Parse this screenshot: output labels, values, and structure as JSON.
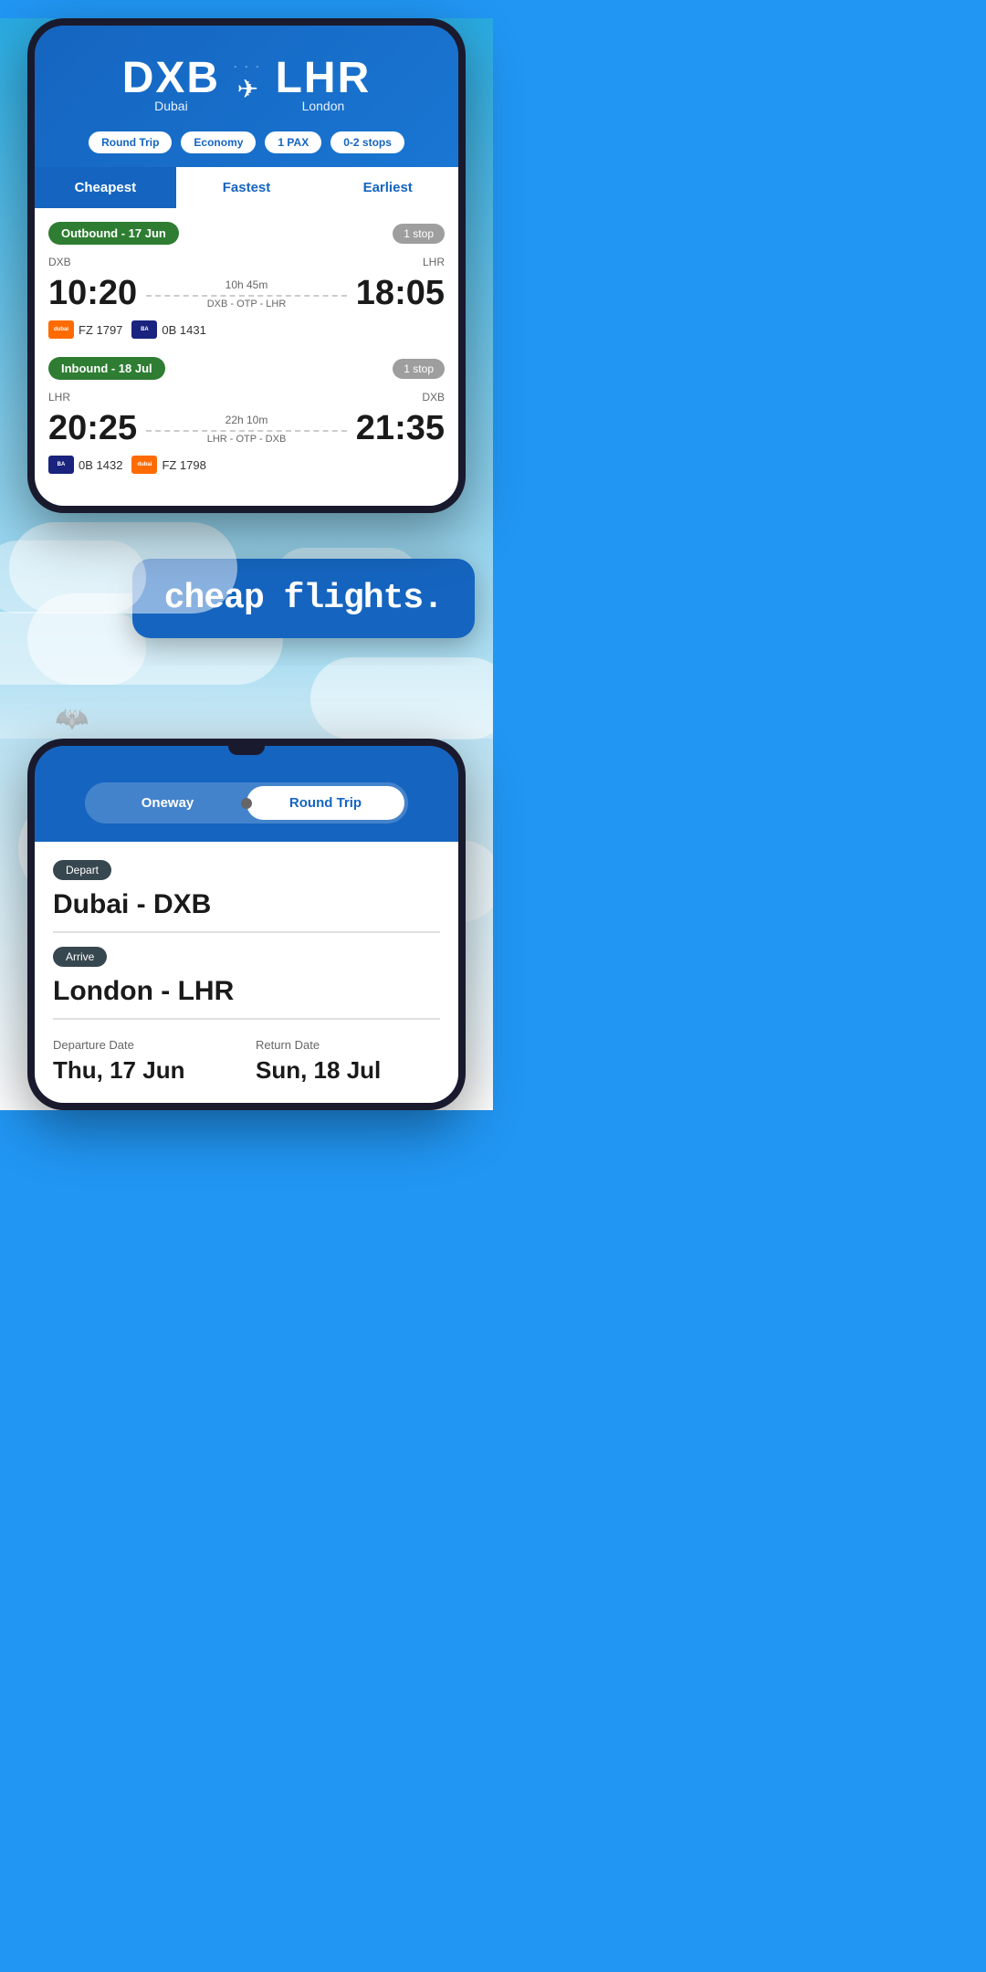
{
  "header": {
    "origin_code": "DXB",
    "origin_city": "Dubai",
    "destination_code": "LHR",
    "destination_city": "London",
    "trip_type": "Round Trip",
    "cabin_class": "Economy",
    "passengers": "1 PAX",
    "stops": "0-2 stops"
  },
  "tabs": {
    "cheapest": "Cheapest",
    "fastest": "Fastest",
    "earliest": "Earliest",
    "active": "cheapest"
  },
  "outbound": {
    "label": "Outbound - 17 Jun",
    "stops_badge": "1 stop",
    "departure_airport": "DXB",
    "arrival_airport": "LHR",
    "departure_time": "10:20",
    "arrival_time": "18:05",
    "duration": "10h 45m",
    "route_path": "DXB - OTP - LHR",
    "airline1_code": "FZ 1797",
    "airline1_color": "orange",
    "airline2_code": "0B 1431",
    "airline2_color": "blue"
  },
  "inbound": {
    "label": "Inbound - 18 Jul",
    "stops_badge": "1 stop",
    "departure_airport": "LHR",
    "arrival_airport": "DXB",
    "departure_time": "20:25",
    "arrival_time": "21:35",
    "duration": "22h 10m",
    "route_path": "LHR - OTP - DXB",
    "airline1_code": "0B 1432",
    "airline1_color": "blue",
    "airline2_code": "FZ 1798",
    "airline2_color": "orange"
  },
  "tagline": "cheap flights.",
  "search_form": {
    "oneway_label": "Oneway",
    "roundtrip_label": "Round Trip",
    "depart_label": "Depart",
    "depart_value": "Dubai - DXB",
    "arrive_label": "Arrive",
    "arrive_value": "London - LHR",
    "departure_date_label": "Departure Date",
    "departure_date_value": "Thu, 17 Jun",
    "return_date_label": "Return Date",
    "return_date_value": "Sun, 18 Jul"
  }
}
